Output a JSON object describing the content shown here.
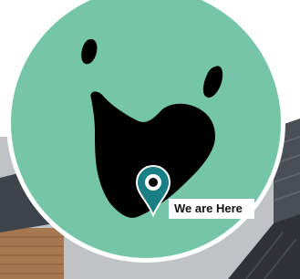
{
  "map": {
    "marker_label": "We are Here",
    "marker_icon": "location-pin-icon",
    "colors": {
      "circle_fill": "#75c6a6",
      "circle_border": "#ffffff",
      "map_island": "#000000",
      "pin": "#1a7f85",
      "pin_dot": "#0b0b0b"
    }
  }
}
